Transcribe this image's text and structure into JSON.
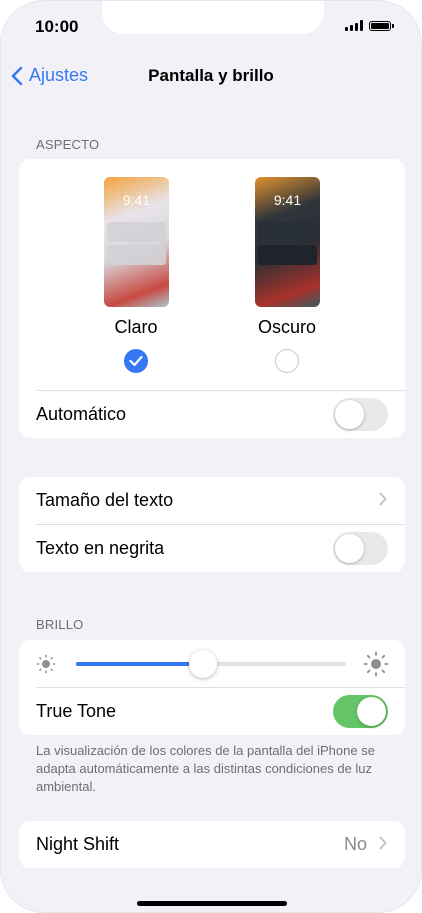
{
  "status_bar": {
    "time": "10:00"
  },
  "nav": {
    "back_label": "Ajustes",
    "title": "Pantalla y brillo"
  },
  "appearance": {
    "header": "ASPECTO",
    "light_label": "Claro",
    "dark_label": "Oscuro",
    "preview_time": "9:41",
    "selected": "Claro",
    "automatic_label": "Automático",
    "automatic_on": false
  },
  "text_settings": {
    "text_size_label": "Tamaño del texto",
    "bold_text_label": "Texto en negrita",
    "bold_text_on": false
  },
  "brightness": {
    "header": "BRILLO",
    "level": 0.47,
    "true_tone_label": "True Tone",
    "true_tone_on": true,
    "footer": "La visualización de los colores de la pantalla del iPhone se adapta automáticamente a las distintas condiciones de luz ambiental."
  },
  "night_shift": {
    "label": "Night Shift",
    "value": "No"
  },
  "colors": {
    "accent": "#3478f6",
    "toggle_on": "#65c466",
    "background": "#f2f1f7"
  }
}
